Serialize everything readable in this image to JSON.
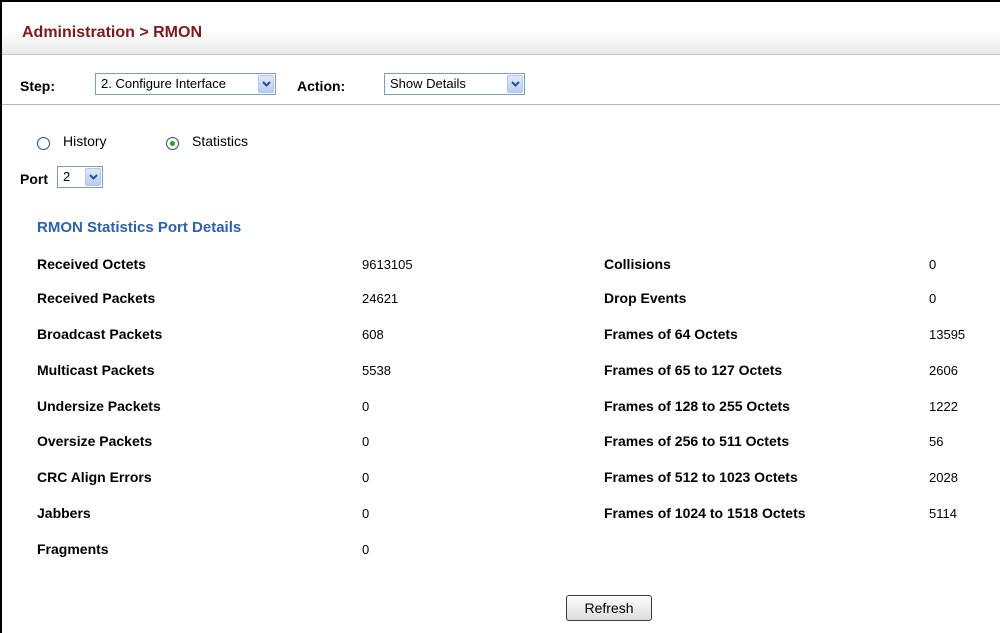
{
  "header": {
    "title": "Administration > RMON"
  },
  "toolbar": {
    "step_label": "Step:",
    "step_value": "2. Configure Interface",
    "action_label": "Action:",
    "action_value": "Show Details"
  },
  "mode": {
    "options": [
      {
        "label": "History",
        "selected": false
      },
      {
        "label": "Statistics",
        "selected": true
      }
    ]
  },
  "port": {
    "label": "Port",
    "value": "2"
  },
  "section": {
    "title": "RMON Statistics Port Details"
  },
  "stats_left": [
    {
      "name": "Received Octets",
      "value": "9613105"
    },
    {
      "name": "Received Packets",
      "value": "24621"
    },
    {
      "name": "Broadcast Packets",
      "value": "608"
    },
    {
      "name": "Multicast Packets",
      "value": "5538"
    },
    {
      "name": "Undersize Packets",
      "value": "0"
    },
    {
      "name": "Oversize Packets",
      "value": "0"
    },
    {
      "name": "CRC Align Errors",
      "value": "0"
    },
    {
      "name": "Jabbers",
      "value": "0"
    },
    {
      "name": "Fragments",
      "value": "0"
    }
  ],
  "stats_right": [
    {
      "name": "Collisions",
      "value": "0"
    },
    {
      "name": "Drop Events",
      "value": "0"
    },
    {
      "name": "Frames of 64 Octets",
      "value": "13595"
    },
    {
      "name": "Frames of 65 to 127 Octets",
      "value": "2606"
    },
    {
      "name": "Frames of 128 to 255 Octets",
      "value": "1222"
    },
    {
      "name": "Frames of 256 to 511 Octets",
      "value": "56"
    },
    {
      "name": "Frames of 512 to 1023 Octets",
      "value": "2028"
    },
    {
      "name": "Frames of 1024 to 1518 Octets",
      "value": "5114"
    }
  ],
  "actions": {
    "refresh_label": "Refresh"
  }
}
